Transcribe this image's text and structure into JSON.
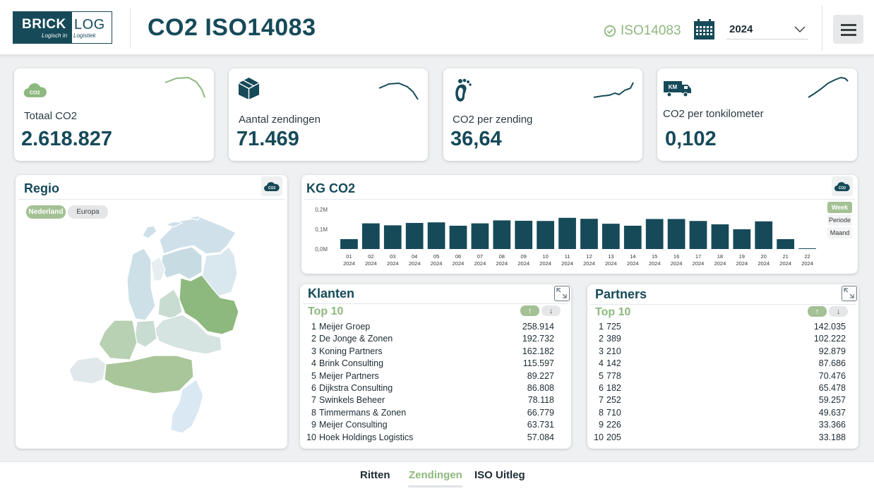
{
  "header": {
    "logo_brick": "BRICK",
    "logo_log": "LOG",
    "logo_tag_left": "Logisch in",
    "logo_tag_right": "Logistiek",
    "title": "CO2 ISO14083",
    "iso_badge": "ISO14083",
    "year": "2024",
    "menu_icon": "hamburger-icon",
    "calendar_icon": "calendar-icon"
  },
  "kpis": [
    {
      "label": "Totaal CO2",
      "value": "2.618.827",
      "icon": "co2-cloud-icon"
    },
    {
      "label": "Aantal zendingen",
      "value": "71.469",
      "icon": "package-icon"
    },
    {
      "label": "CO2 per zending",
      "value": "36,64",
      "icon": "footprint-icon"
    },
    {
      "label": "CO2 per tonkilometer",
      "value": "0,102",
      "icon": "truck-km-icon"
    }
  ],
  "regio": {
    "title": "Regio",
    "toggles": [
      "Nederland",
      "Europa"
    ],
    "active": "Nederland"
  },
  "chart": {
    "title": "KG CO2",
    "modes": [
      "Week",
      "Periode",
      "Maand"
    ],
    "active_mode": "Week"
  },
  "chart_data": {
    "type": "bar",
    "title": "KG CO2",
    "categories": [
      "01\n2024",
      "02\n2024",
      "03\n2024",
      "04\n2024",
      "05\n2024",
      "06\n2024",
      "07\n2024",
      "08\n2024",
      "09\n2024",
      "10\n2024",
      "11\n2024",
      "12\n2024",
      "13\n2024",
      "14\n2024",
      "15\n2024",
      "16\n2024",
      "17\n2024",
      "18\n2024",
      "19\n2024",
      "20\n2024",
      "21\n2024",
      "22\n2024"
    ],
    "x_week": [
      "01",
      "02",
      "03",
      "04",
      "05",
      "06",
      "07",
      "08",
      "09",
      "10",
      "11",
      "12",
      "13",
      "14",
      "15",
      "16",
      "17",
      "18",
      "19",
      "20",
      "21",
      "22"
    ],
    "x_year": "2024",
    "values": [
      50000,
      130000,
      120000,
      132000,
      135000,
      118000,
      130000,
      145000,
      143000,
      142000,
      158000,
      153000,
      128000,
      118000,
      152000,
      152000,
      142000,
      125000,
      100000,
      140000,
      50000,
      3000
    ],
    "yticks": [
      "0,0M",
      "0,1M",
      "0,2M"
    ],
    "ylim": [
      0,
      200000
    ],
    "bar_color": "#164a59"
  },
  "klanten": {
    "title": "Klanten",
    "subtitle": "Top 10",
    "rows": [
      {
        "rank": "1",
        "name": "Meijer Groep",
        "value": "258.914"
      },
      {
        "rank": "2",
        "name": "De Jonge & Zonen",
        "value": "192.732"
      },
      {
        "rank": "3",
        "name": "Koning Partners",
        "value": "162.182"
      },
      {
        "rank": "4",
        "name": "Brink Consulting",
        "value": "115.597"
      },
      {
        "rank": "5",
        "name": "Meijer Partners",
        "value": "89.227"
      },
      {
        "rank": "6",
        "name": "Dijkstra Consulting",
        "value": "86.808"
      },
      {
        "rank": "7",
        "name": "Swinkels Beheer",
        "value": "78.118"
      },
      {
        "rank": "8",
        "name": "Timmermans & Zonen",
        "value": "66.779"
      },
      {
        "rank": "9",
        "name": "Meijer Consulting",
        "value": "63.731"
      },
      {
        "rank": "10",
        "name": "Hoek Holdings Logistics",
        "value": "57.084"
      }
    ]
  },
  "partners": {
    "title": "Partners",
    "subtitle": "Top 10",
    "rows": [
      {
        "rank": "1",
        "name": "725",
        "value": "142.035"
      },
      {
        "rank": "2",
        "name": "389",
        "value": "102.222"
      },
      {
        "rank": "3",
        "name": "210",
        "value": "92.879"
      },
      {
        "rank": "4",
        "name": "142",
        "value": "87.686"
      },
      {
        "rank": "5",
        "name": "778",
        "value": "70.476"
      },
      {
        "rank": "6",
        "name": "182",
        "value": "65.478"
      },
      {
        "rank": "7",
        "name": "252",
        "value": "59.257"
      },
      {
        "rank": "8",
        "name": "710",
        "value": "49.637"
      },
      {
        "rank": "9",
        "name": "226",
        "value": "33.366"
      },
      {
        "rank": "10",
        "name": "205",
        "value": "33.188"
      }
    ]
  },
  "nav": {
    "tabs": [
      "Ritten",
      "Zendingen",
      "ISO Uitleg"
    ],
    "active": "Zendingen"
  },
  "colors": {
    "accent_green": "#8db87e",
    "brand_dark": "#164a59"
  }
}
